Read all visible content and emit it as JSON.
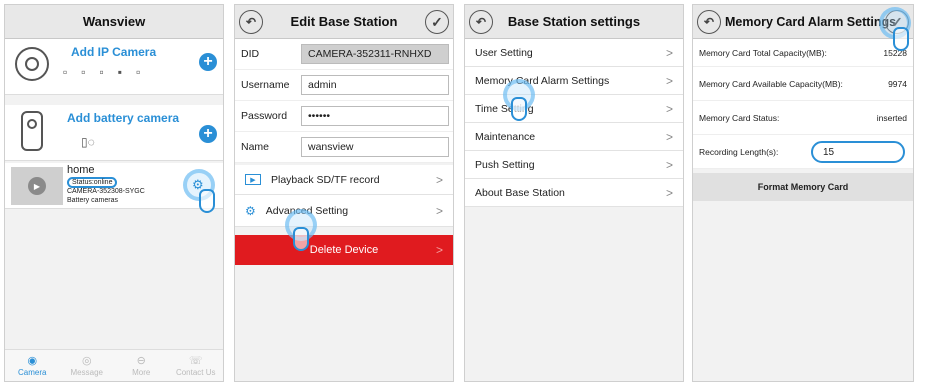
{
  "panel1": {
    "title": "Wansview",
    "add_ip_camera": "Add IP Camera",
    "add_battery_camera": "Add battery camera",
    "device": {
      "name": "home",
      "status": "Status:online",
      "id": "CAMERA-352308-SYGC",
      "type": "Battery cameras"
    },
    "tabs": [
      {
        "label": "Camera",
        "icon": "camera-icon"
      },
      {
        "label": "Message",
        "icon": "message-icon"
      },
      {
        "label": "More",
        "icon": "more-icon"
      },
      {
        "label": "Contact Us",
        "icon": "contact-icon"
      }
    ]
  },
  "panel2": {
    "title": "Edit Base Station",
    "fields": [
      {
        "label": "DID",
        "value": "CAMERA-352311-RNHXD"
      },
      {
        "label": "Username",
        "value": "admin"
      },
      {
        "label": "Password",
        "value": "••••••"
      },
      {
        "label": "Name",
        "value": "wansview"
      }
    ],
    "playback": "Playback SD/TF record",
    "advanced": "Advanced Setting",
    "delete": "Delete Device"
  },
  "panel3": {
    "title": "Base Station settings",
    "items": [
      "User Setting",
      "Memory Card Alarm Settings",
      "Time Setting",
      "Maintenance",
      "Push Setting",
      "About Base Station"
    ]
  },
  "panel4": {
    "title": "Memory Card Alarm Settings",
    "rows": [
      {
        "label": "Memory Card Total Capacity(MB):",
        "value": "15228"
      },
      {
        "label": "Memory Card Available Capacity(MB):",
        "value": "9974"
      },
      {
        "label": "Memory Card Status:",
        "value": "inserted"
      }
    ],
    "recording_label": "Recording Length(s):",
    "recording_value": "15",
    "format_button": "Format Memory Card"
  },
  "colors": {
    "accent": "#2a8fd6",
    "danger": "#e01b1f"
  }
}
